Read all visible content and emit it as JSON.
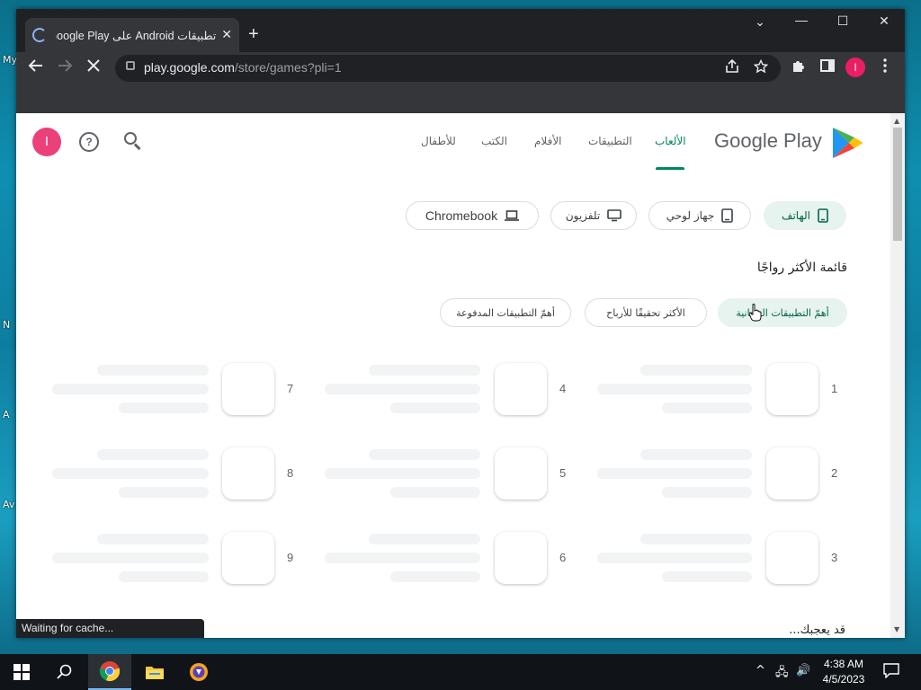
{
  "desktop": {
    "labels": [
      "My",
      "N",
      "A",
      "Av"
    ]
  },
  "browser": {
    "tab_title": "تطبيقات Android على Google Play",
    "tab_close": "✕",
    "new_tab": "+",
    "window_controls": {
      "dropdown": "⌄",
      "minimize": "—",
      "maximize": "☐",
      "close": "✕"
    },
    "url_domain": "play.google.com",
    "url_path": "/store/games?pli=1",
    "profile_initial": "I",
    "status_text": "Waiting for cache..."
  },
  "header": {
    "avatar_initial": "I",
    "help_label": "?",
    "logo_text": "Google Play",
    "nav": [
      {
        "label": "الألعاب",
        "active": true
      },
      {
        "label": "التطبيقات",
        "active": false
      },
      {
        "label": "الأفلام",
        "active": false
      },
      {
        "label": "الكتب",
        "active": false
      },
      {
        "label": "للأطفال",
        "active": false
      }
    ]
  },
  "device_chips": [
    {
      "label": "الهاتف",
      "icon": "phone-icon",
      "active": true
    },
    {
      "label": "جهاز لوحي",
      "icon": "tablet-icon",
      "active": false
    },
    {
      "label": "تلفزيون",
      "icon": "tv-icon",
      "active": false
    },
    {
      "label": "Chromebook",
      "icon": "laptop-icon",
      "active": false
    }
  ],
  "section_title": "قائمة الأكثر رواجًا",
  "ranking_chips": [
    {
      "label": "أهمّ التطبيقات المجانية",
      "active": true
    },
    {
      "label": "الأكثر تحقيقًا للأرباح",
      "active": false
    },
    {
      "label": "أهمّ التطبيقات المدفوعة",
      "active": false
    }
  ],
  "ranked_items": [
    "1",
    "2",
    "3",
    "4",
    "5",
    "6",
    "7",
    "8",
    "9"
  ],
  "footer_peek": "قد يعجبك...",
  "taskbar": {
    "clock_time": "4:38 AM",
    "clock_date": "4/5/2023",
    "tray_chevron": "^",
    "tray_volume": "🔊",
    "tray_network": "🖧",
    "notifications": "💬"
  },
  "colors": {
    "play_green": "#01875f",
    "chip_active_bg": "#e6f3ef",
    "avatar_pink": "#ec407a"
  }
}
